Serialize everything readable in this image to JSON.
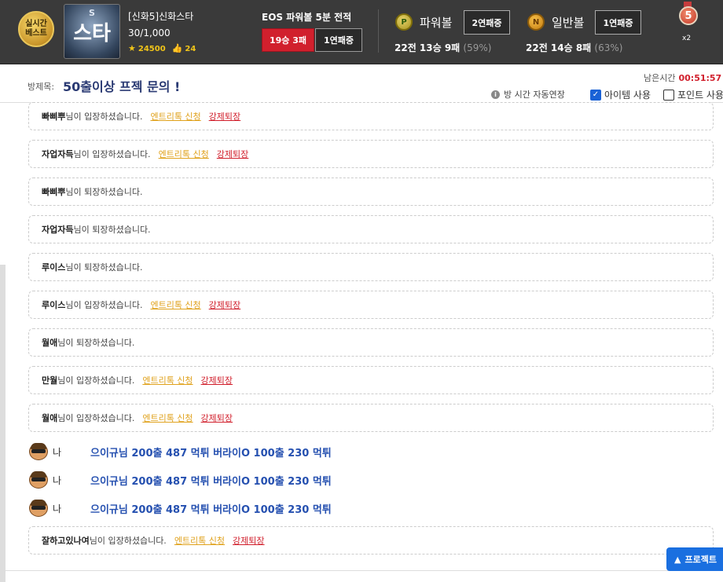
{
  "header": {
    "badge_lines": [
      "실시간",
      "베스트"
    ],
    "avatar_text": "스타",
    "avatar_mark": "S",
    "user_name": "[신화5]신화스타",
    "user_count": "30/1,000",
    "stars": "24500",
    "likes": "24",
    "eos_title": "EOS 파워볼 5분 전적",
    "eos_record": "19승 3패",
    "eos_streak": "1연패중",
    "powerball": {
      "ball_letter": "P",
      "label": "파워볼",
      "streak": "2연패중",
      "record": "22전 13승 9패",
      "pct": "(59%)"
    },
    "normalball": {
      "ball_letter": "N",
      "label": "일반볼",
      "streak": "1연패중",
      "record": "22전 14승 8패",
      "pct": "(63%)"
    },
    "medal_number": "5",
    "medal_multiplier": "x2"
  },
  "room": {
    "label": "방제목:",
    "title": "50출이상 프젝 문의 !",
    "remain_label": "남은시간",
    "remain_time": "00:51:57",
    "auto_extend": "방 시간 자동연장",
    "item_label": "아이템 사용",
    "item_checked": true,
    "point_label": "포인트 사용",
    "point_checked": false
  },
  "links": {
    "entry": "엔트리톡 신청",
    "kick": "강제퇴장"
  },
  "messages": [
    {
      "type": "sys",
      "nick": "빠삐뿌",
      "action": "님이 입장하셨습니다.",
      "links": true
    },
    {
      "type": "sys",
      "nick": "자업자득",
      "action": "님이 입장하셨습니다.",
      "links": true
    },
    {
      "type": "sys",
      "nick": "빠삐뿌",
      "action": "님이 퇴장하셨습니다.",
      "links": false
    },
    {
      "type": "sys",
      "nick": "자업자득",
      "action": "님이 퇴장하셨습니다.",
      "links": false
    },
    {
      "type": "sys",
      "nick": "루이스",
      "action": "님이 퇴장하셨습니다.",
      "links": false
    },
    {
      "type": "sys",
      "nick": "루이스",
      "action": "님이 입장하셨습니다.",
      "links": true
    },
    {
      "type": "sys",
      "nick": "월애",
      "action": "님이 퇴장하셨습니다.",
      "links": false
    },
    {
      "type": "sys",
      "nick": "만월",
      "action": "님이 입장하셨습니다.",
      "links": true
    },
    {
      "type": "sys",
      "nick": "월애",
      "action": "님이 입장하셨습니다.",
      "links": true
    },
    {
      "type": "chat",
      "who": "나",
      "text": "으이규님 200출 487 먹튀 버라이O 100출 230 먹튀"
    },
    {
      "type": "chat",
      "who": "나",
      "text": "으이규님 200출 487 먹튀 버라이O 100출 230 먹튀"
    },
    {
      "type": "chat",
      "who": "나",
      "text": "으이규님 200출 487 먹튀 버라이O 100출 230 먹튀"
    },
    {
      "type": "sys",
      "nick": "잘하고있나여",
      "action": "님이 입장하셨습니다.",
      "links": true
    }
  ],
  "float_button": "프로젝트"
}
